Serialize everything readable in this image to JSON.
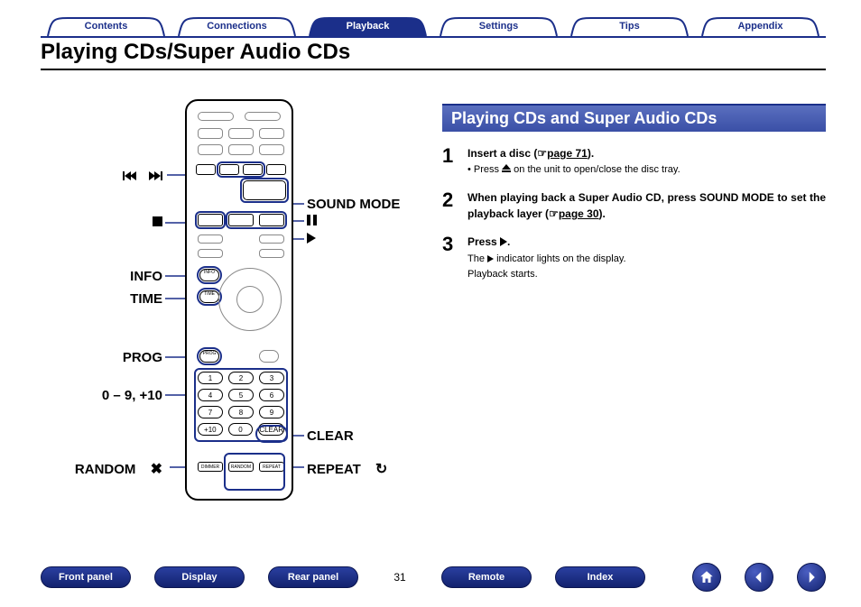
{
  "tabs": {
    "contents": "Contents",
    "connections": "Connections",
    "playback": "Playback",
    "settings": "Settings",
    "tips": "Tips",
    "appendix": "Appendix"
  },
  "title": "Playing CDs/Super Audio CDs",
  "section_title": "Playing CDs and Super Audio CDs",
  "steps": {
    "s1": {
      "num": "1",
      "title_a": "Insert a disc (",
      "title_link": "page 71",
      "title_b": ").",
      "sub": " on the unit to open/close the disc tray.",
      "sub_prefix": "Press "
    },
    "s2": {
      "num": "2",
      "title_a": "When playing back a Super Audio CD, press SOUND MODE to set the playback layer (",
      "title_link": "page 30",
      "title_b": ")."
    },
    "s3": {
      "num": "3",
      "title_a": "Press ",
      "title_b": ".",
      "sub_a": "The ",
      "sub_b": " indicator lights on the display.",
      "sub_c": "Playback starts."
    }
  },
  "callouts": {
    "sound_mode": "SOUND MODE",
    "info": "INFO",
    "time": "TIME",
    "prog": "PROG",
    "digits": "0 – 9, +10",
    "random": "RANDOM",
    "clear": "CLEAR",
    "repeat": "REPEAT"
  },
  "remote": {
    "info_btn": "INFO",
    "time_btn": "TIME",
    "prog_btn": "PROG",
    "clear_btn": "CLEAR",
    "plus10": "+10",
    "nums": [
      "1",
      "2",
      "3",
      "4",
      "5",
      "6",
      "7",
      "8",
      "9",
      "0"
    ],
    "bottom": {
      "dimmer": "DIMMER",
      "random": "RANDOM",
      "repeat": "REPEAT"
    }
  },
  "footer": {
    "front_panel": "Front panel",
    "display": "Display",
    "rear_panel": "Rear panel",
    "page": "31",
    "remote": "Remote",
    "index": "Index"
  },
  "icons": {
    "pointer": "☞"
  }
}
